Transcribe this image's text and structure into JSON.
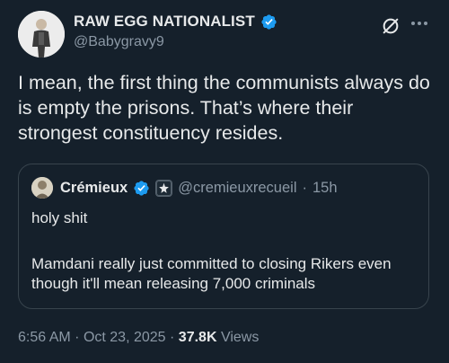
{
  "author": {
    "name": "RAW EGG NATIONALIST",
    "handle": "@Babygravy9"
  },
  "tweet": {
    "text": "I mean, the first thing the communists always do is empty the prisons. That’s where their strongest constituency resides."
  },
  "quote": {
    "name": "Crémieux",
    "handle": "@cremieuxrecueil",
    "separator": "·",
    "time": "15h",
    "line1": "holy shit",
    "body": "Mamdani really just committed to closing Rikers even though it'll mean releasing 7,000 criminals"
  },
  "meta": {
    "time": "6:56 AM",
    "sep1": "·",
    "date": "Oct 23, 2025",
    "sep2": "·",
    "views_count": "37.8K",
    "views_label": "Views"
  },
  "icons": {
    "verified": "verified-badge-icon",
    "grok": "grok-icon",
    "more": "more-icon"
  },
  "colors": {
    "background": "#15202b",
    "text": "#e7e9ea",
    "secondary": "#8b98a5",
    "verified": "#1d9bf0",
    "border": "#38444d"
  }
}
